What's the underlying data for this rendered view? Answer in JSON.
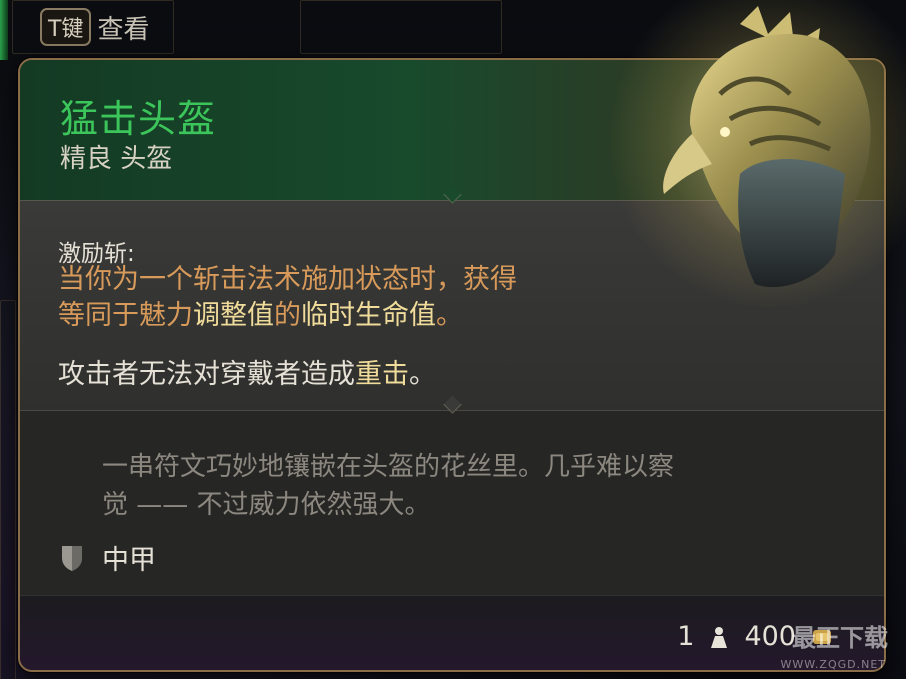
{
  "hint": {
    "key": "T键",
    "action": "查看"
  },
  "item": {
    "name": "猛击头盔",
    "type_line": "精良 头盔",
    "name_color": "#3cc55a"
  },
  "effect": {
    "title": "激励斩:",
    "body_part1": "当你为一个斩击法术施加状态时，获得",
    "body_part2": "等同于魅力",
    "body_hl1": "调整值",
    "body_part3": "的",
    "body_hl2": "临时生命值",
    "body_part4": "。"
  },
  "passive": {
    "part1": "攻击者无法对穿戴者造成",
    "hl": "重击",
    "part2": "。"
  },
  "flavor": {
    "line1": "一串符文巧妙地镶嵌在头盔的花丝里。几乎难以察",
    "line2": "觉 —— 不过威力依然强大。"
  },
  "armor": {
    "icon": "shield-icon",
    "label": "中甲"
  },
  "footer": {
    "weight": "1",
    "weight_icon": "weight-icon",
    "price": "400",
    "price_icon": "coin-icon"
  },
  "watermark": {
    "main": "最正下载",
    "sub": "WWW.ZQGD.NET"
  }
}
